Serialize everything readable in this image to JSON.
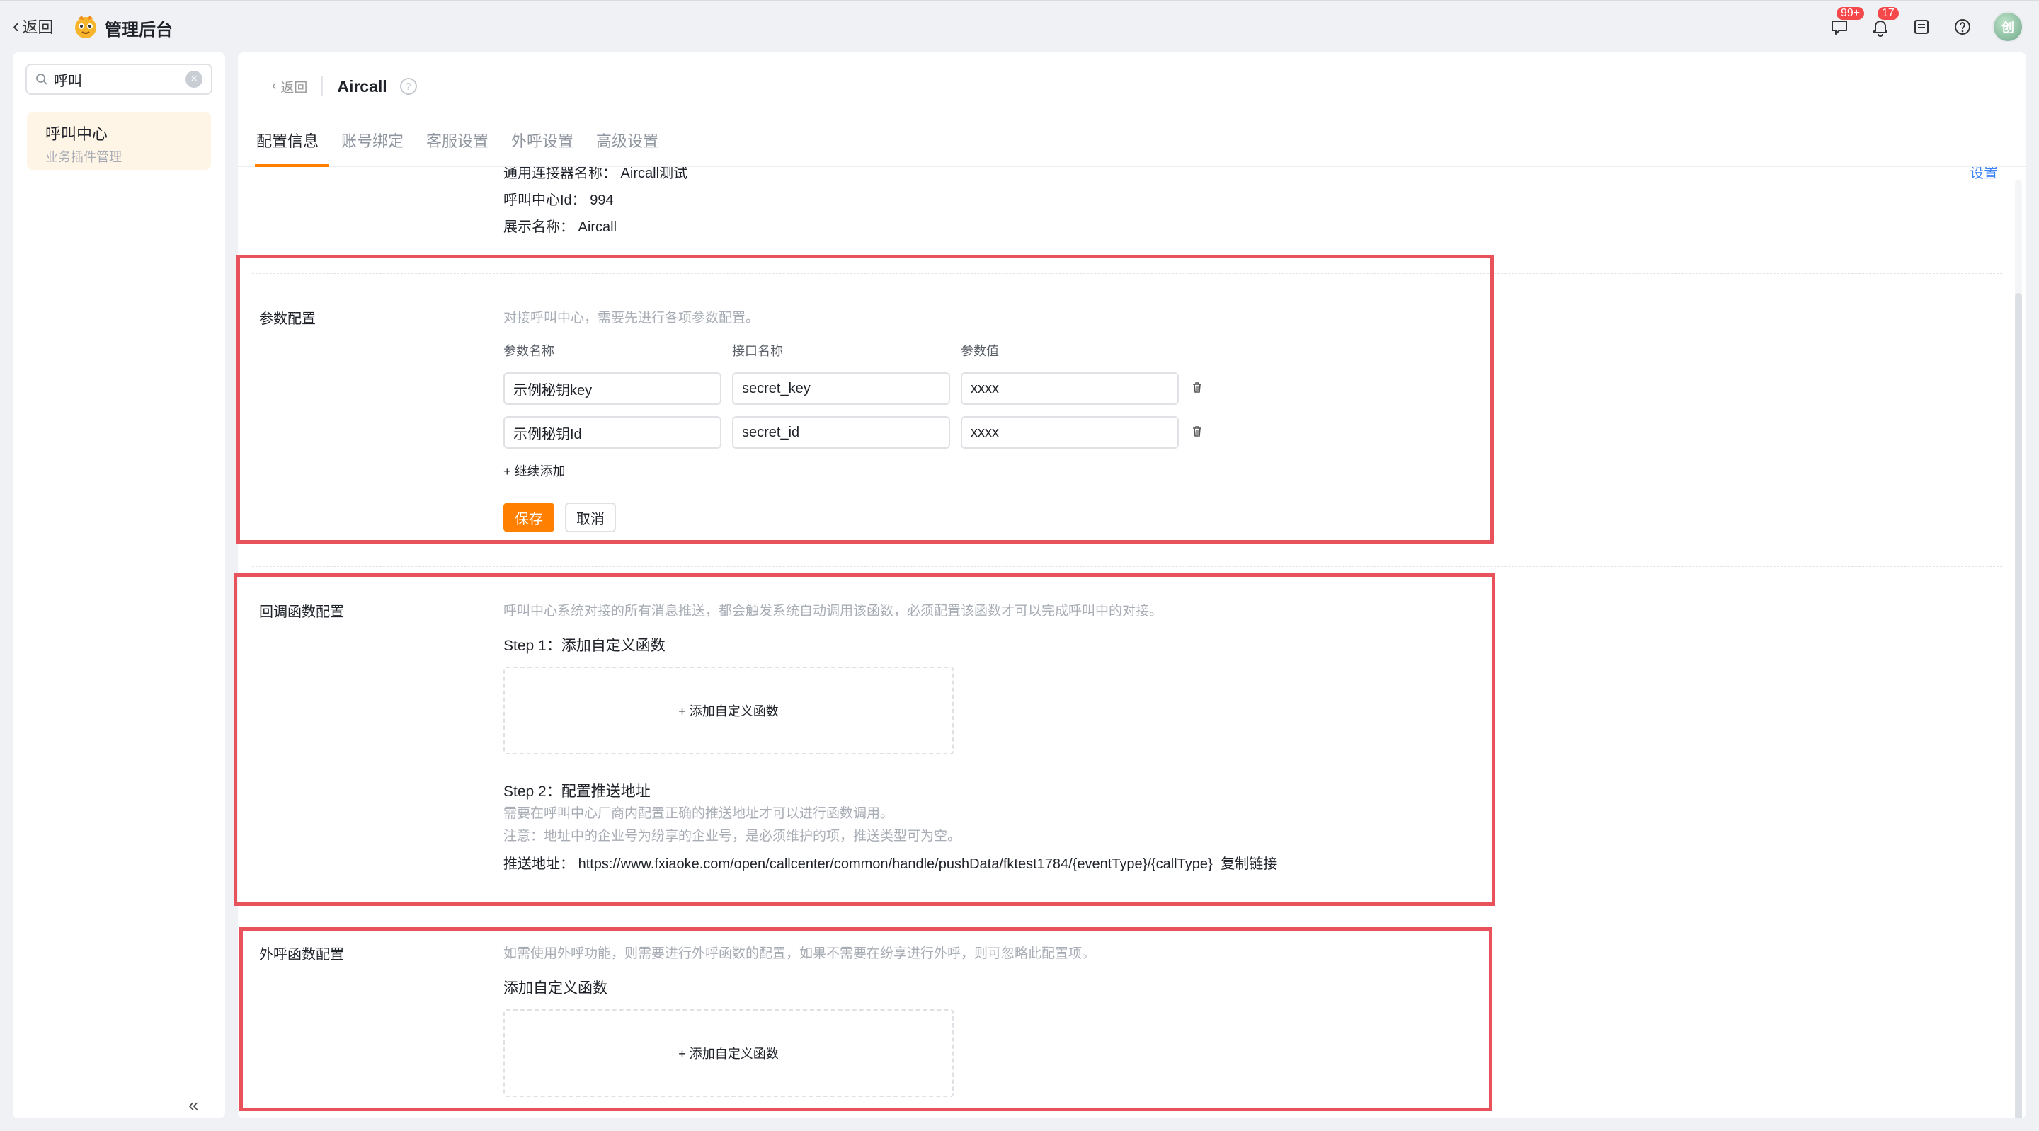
{
  "topbar": {
    "back_label": "返回",
    "app_title": "管理后台",
    "messages_badge": "99+",
    "notifications_badge": "17",
    "avatar_text": "创"
  },
  "sidebar": {
    "search_value": "呼叫",
    "items": [
      {
        "title": "呼叫中心",
        "subtitle": "业务插件管理"
      }
    ]
  },
  "main": {
    "back_label": "返回",
    "plugin_name": "Aircall",
    "tabs": [
      {
        "label": "配置信息",
        "active": true
      },
      {
        "label": "账号绑定",
        "active": false
      },
      {
        "label": "客服设置",
        "active": false
      },
      {
        "label": "外呼设置",
        "active": false
      },
      {
        "label": "高级设置",
        "active": false
      }
    ],
    "settings_link": "设置",
    "basic": {
      "connector": "通用连接器名称：  Aircall测试",
      "center_id": "呼叫中心Id：  994",
      "display_name": "展示名称：  Aircall"
    },
    "params": {
      "label": "参数配置",
      "desc": "对接呼叫中心，需要先进行各项参数配置。",
      "col_name": "参数名称",
      "col_api": "接口名称",
      "col_value": "参数值",
      "rows": [
        {
          "name": "示例秘钥key",
          "api": "secret_key",
          "value": "xxxx"
        },
        {
          "name": "示例秘钥Id",
          "api": "secret_id",
          "value": "xxxx"
        }
      ],
      "add_more": "+ 继续添加",
      "save": "保存",
      "cancel": "取消"
    },
    "callback": {
      "label": "回调函数配置",
      "desc": "呼叫中心系统对接的所有消息推送，都会触发系统自动调用该函数，必须配置该函数才可以完成呼叫中的对接。",
      "step1": "Step 1：添加自定义函数",
      "add_fn": "+ 添加自定义函数",
      "step2": "Step 2：配置推送地址",
      "step2_note1": "需要在呼叫中心厂商内配置正确的推送地址才可以进行函数调用。",
      "step2_note2": "注意：地址中的企业号为纷享的企业号，是必须维护的项，推送类型可为空。",
      "push_label": "推送地址：",
      "push_url": "https://www.fxiaoke.com/open/callcenter/common/handle/pushData/fktest1784/{eventType}/{callType}",
      "copy_link": "复制链接"
    },
    "outbound": {
      "label": "外呼函数配置",
      "desc": "如需使用外呼功能，则需要进行外呼函数的配置，如果不需要在纷享进行外呼，则可忽略此配置项。",
      "title": "添加自定义函数",
      "add_fn": "+ 添加自定义函数"
    }
  },
  "annotation_color": "#e8525b",
  "accent_color": "#ff8000"
}
